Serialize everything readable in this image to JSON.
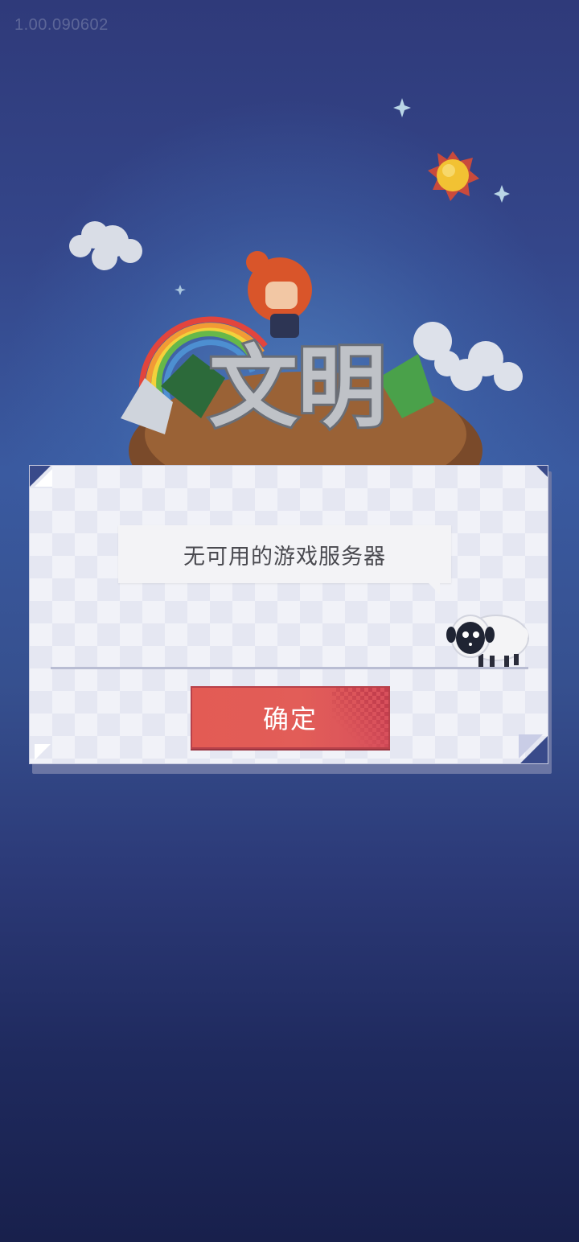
{
  "version_label": "1.00.090602",
  "logo_text": "文明",
  "dialog": {
    "message": "无可用的游戏服务器",
    "confirm_label": "确定"
  },
  "colors": {
    "background_top": "#2f3a7a",
    "background_bottom": "#18204c",
    "dialog_bg": "#e5e7f2",
    "button_red": "#e35b54"
  },
  "icons": [
    "sparkle-icon",
    "sun-icon",
    "cloud-icon",
    "rainbow-icon",
    "sheep-icon"
  ]
}
